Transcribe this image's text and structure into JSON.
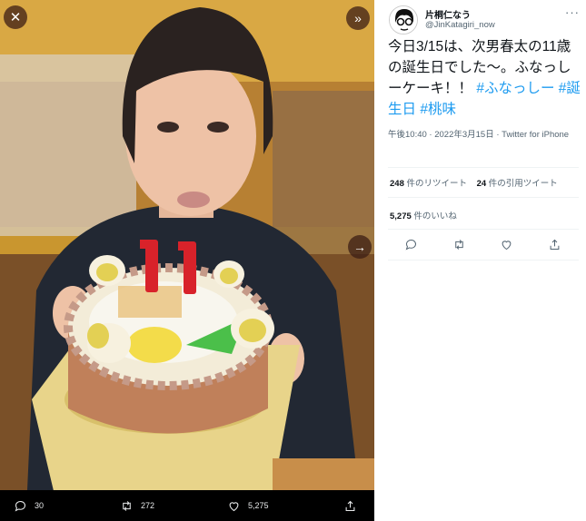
{
  "viewer": {
    "close_icon": "close-icon",
    "expand_icon": "double-chevron-right-icon",
    "next_icon": "arrow-right-icon",
    "actions": {
      "reply_count": "30",
      "retweet_count": "272",
      "like_count": "5,275"
    }
  },
  "tweet": {
    "display_name": "片桐仁なう",
    "handle": "@JinKatagiri_now",
    "text": "今日3/15は、次男春太の11歳の誕生日でした〜。ふなっしーケーキ！！",
    "hashtags": [
      "#ふなっしー",
      "#誕生日",
      "#桃味"
    ],
    "time": "午後10:40",
    "separator": "·",
    "date": "2022年3月15日",
    "source": "Twitter for iPhone",
    "retweets": {
      "count": "248",
      "label": "件のリツイート"
    },
    "quotes": {
      "count": "24",
      "label": "件の引用ツイート"
    },
    "likes": {
      "count": "5,275",
      "label": "件のいいね"
    }
  },
  "colors": {
    "link": "#1d9bf0",
    "text": "#0f1419",
    "muted": "#536471",
    "viewer_bg": "#000000"
  }
}
